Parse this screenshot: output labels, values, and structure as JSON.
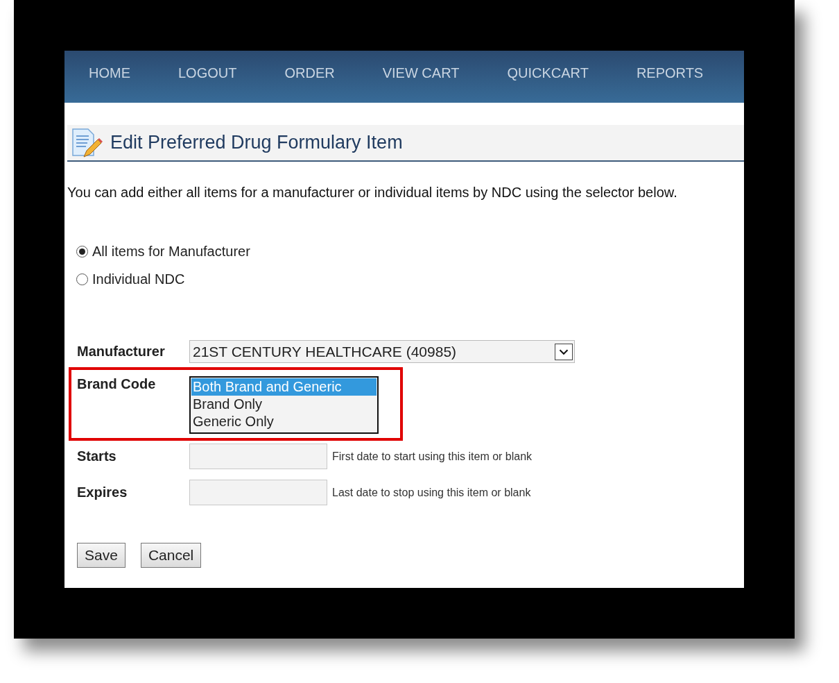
{
  "nav": [
    {
      "label": "HOME"
    },
    {
      "label": "LOGOUT"
    },
    {
      "label": "ORDER"
    },
    {
      "label": "VIEW CART"
    },
    {
      "label": "QUICKCART"
    },
    {
      "label": "REPORTS"
    }
  ],
  "title": "Edit Preferred Drug Formulary Item",
  "intro": "You can add either all items for a manufacturer or individual items by NDC using the selector below.",
  "scope_options": [
    {
      "label": "All items for Manufacturer",
      "selected": true
    },
    {
      "label": "Individual NDC",
      "selected": false
    }
  ],
  "manufacturer": {
    "label": "Manufacturer",
    "value": "21ST CENTURY HEALTHCARE (40985)"
  },
  "brand_code": {
    "label": "Brand Code",
    "options": [
      {
        "label": "Both Brand and Generic",
        "selected": true
      },
      {
        "label": "Brand Only",
        "selected": false
      },
      {
        "label": "Generic Only",
        "selected": false
      }
    ]
  },
  "dates": [
    {
      "label": "Starts",
      "hint": "First date to start using this item or blank"
    },
    {
      "label": "Expires",
      "hint": "Last date to stop using this item or blank"
    }
  ],
  "buttons": [
    "Save",
    "Cancel"
  ]
}
